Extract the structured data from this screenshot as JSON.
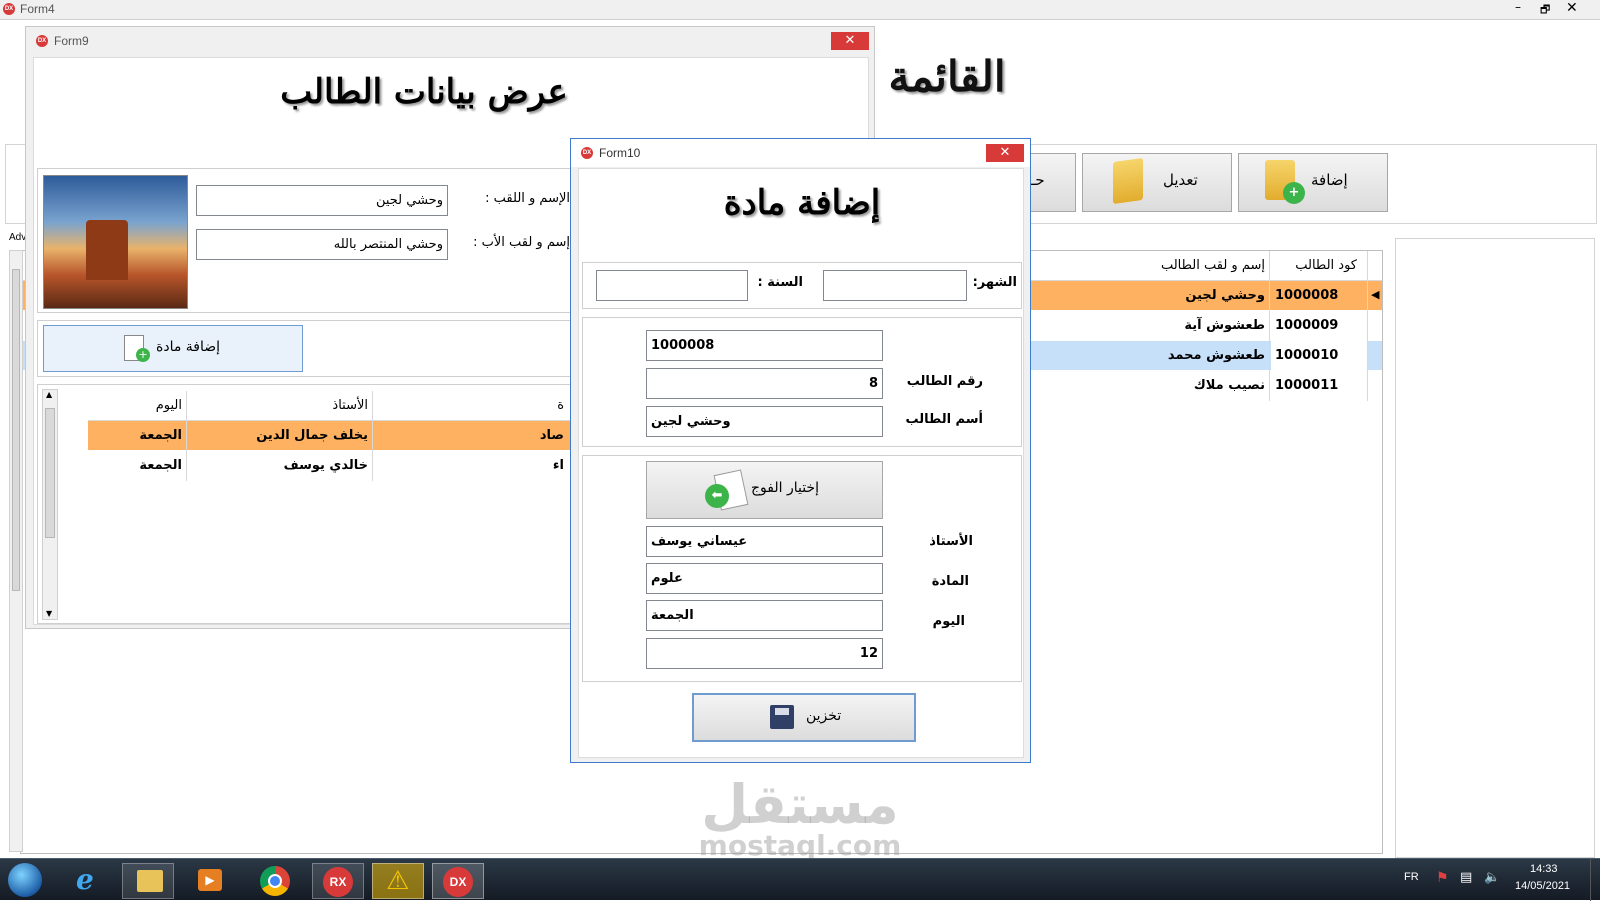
{
  "form4": {
    "title": "Form4",
    "heading": "القائمة",
    "toolbar": {
      "add_label": "إضافة",
      "edit_label": "تعديل",
      "delete_label": "حـ"
    },
    "grid": {
      "columns": [
        "كود الطالب",
        "إسم و لقب الطالب"
      ],
      "rows": [
        {
          "code": "1000008",
          "name": "وحشي لجين"
        },
        {
          "code": "1000009",
          "name": "طعشوش آية"
        },
        {
          "code": "1000010",
          "name": "طعشوش محمد"
        },
        {
          "code": "1000011",
          "name": "نصيب ملاك"
        }
      ]
    },
    "side_tab_label": "Adv"
  },
  "form9": {
    "title": "Form9",
    "heading": "عرض بيانات الطالب",
    "name_label": "الإسم و اللقب :",
    "name_value": "وحشي لجين",
    "father_label": "إسم و لقب الأب :",
    "father_value": "وحشي المنتصر بالله",
    "add_subject_label": "إضافة مادة",
    "grid": {
      "columns": [
        "اليوم",
        "الأستاذ",
        "ة"
      ],
      "rows": [
        {
          "day": "الجمعة",
          "teacher": "يخلف جمال الدين",
          "subject": "صاد"
        },
        {
          "day": "الجمعة",
          "teacher": "خالدي يوسف",
          "subject": "اء"
        }
      ]
    }
  },
  "form10": {
    "title": "Form10",
    "heading": "إضافة مادة",
    "month_label": "الشهر:",
    "month_value": "",
    "year_label": "السنة :",
    "year_value": "",
    "code_value": "1000008",
    "student_number_label": "رقم الطالب",
    "student_number_value": "8",
    "student_name_label": "أسم الطالب",
    "student_name_value": "وحشي لجين",
    "choose_group_label": "إختيار الفوج",
    "teacher_label": "الأستاذ",
    "teacher_value": "عيساني يوسف",
    "subject_label": "المادة",
    "subject_value": "علوم",
    "day_label": "اليوم",
    "day_value": "الجمعة",
    "extra_value": "12",
    "save_label": "تخزين"
  },
  "watermark": {
    "arabic": "مستقل",
    "latin": "mostaql.com"
  },
  "taskbar": {
    "lang": "FR",
    "time": "14:33",
    "date": "14/05/2021",
    "apps": [
      "start-orb-icon",
      "internet-explorer-icon",
      "file-explorer-icon",
      "media-player-icon",
      "chrome-icon",
      "rx-icon",
      "warning-icon",
      "dx-icon"
    ]
  },
  "colors": {
    "selection": "#ffb162",
    "selection_blue": "#c7e0f9",
    "accent_red": "#d83a3a",
    "taskbar": "#1c2530"
  }
}
